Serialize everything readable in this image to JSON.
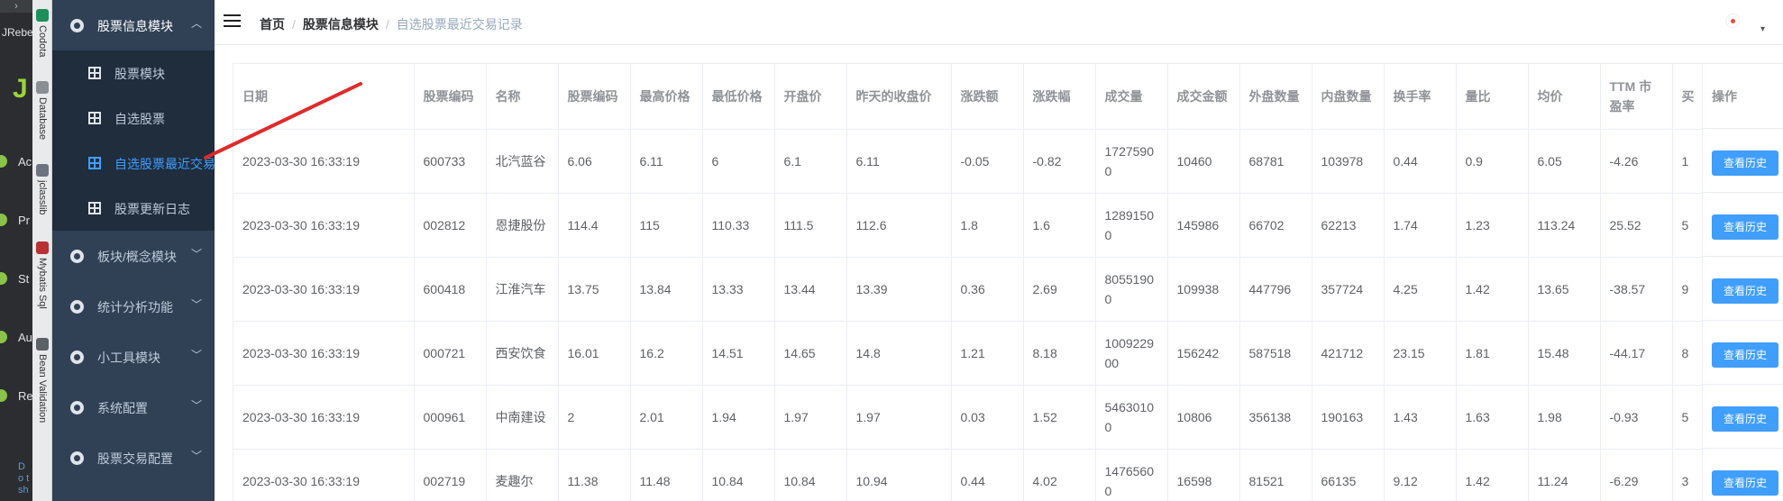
{
  "ide": {
    "plugin_label": "JRebe",
    "logo_letter": "J",
    "left_items": [
      {
        "label": "Ac"
      },
      {
        "label": "Pr"
      },
      {
        "label": "St"
      },
      {
        "label": "Au"
      },
      {
        "label": "Re"
      }
    ],
    "bottom_link": "Do t sh",
    "vertical_tools": [
      "Codota",
      "Database",
      "jclasslib",
      "Mybatis Sql",
      "Bean Validation"
    ]
  },
  "sidebar": {
    "groups": [
      {
        "label": "股票信息模块",
        "open": true
      },
      {
        "label": "板块/概念模块"
      },
      {
        "label": "统计分析功能"
      },
      {
        "label": "小工具模块"
      },
      {
        "label": "系统配置"
      },
      {
        "label": "股票交易配置"
      }
    ],
    "sub_items": [
      {
        "label": "股票模块"
      },
      {
        "label": "自选股票"
      },
      {
        "label": "自选股票最近交易记录",
        "active": true
      },
      {
        "label": "股票更新日志"
      }
    ]
  },
  "breadcrumb": {
    "home": "首页",
    "module": "股票信息模块",
    "current": "自选股票最近交易记录",
    "sep": "/"
  },
  "table": {
    "headers": [
      "日期",
      "股票编码",
      "名称",
      "股票编码",
      "最高价格",
      "最低价格",
      "开盘价",
      "昨天的收盘价",
      "涨跌额",
      "涨跌幅",
      "成交量",
      "成交金额",
      "外盘数量",
      "内盘数量",
      "换手率",
      "量比",
      "均价",
      "TTM 市盈率",
      "买"
    ],
    "op_header": "操作",
    "op_button": "查看历史",
    "rows": [
      [
        "2023-03-30 16:33:19",
        "600733",
        "北汽蓝谷",
        "6.06",
        "6.11",
        "6",
        "6.1",
        "6.11",
        "-0.05",
        "-0.82",
        "17275900",
        "10460",
        "68781",
        "103978",
        "0.44",
        "0.9",
        "6.05",
        "-4.26",
        "1"
      ],
      [
        "2023-03-30 16:33:19",
        "002812",
        "恩捷股份",
        "114.4",
        "115",
        "110.33",
        "111.5",
        "112.6",
        "1.8",
        "1.6",
        "12891500",
        "145986",
        "66702",
        "62213",
        "1.74",
        "1.23",
        "113.24",
        "25.52",
        "5"
      ],
      [
        "2023-03-30 16:33:19",
        "600418",
        "江淮汽车",
        "13.75",
        "13.84",
        "13.33",
        "13.44",
        "13.39",
        "0.36",
        "2.69",
        "80551900",
        "109938",
        "447796",
        "357724",
        "4.25",
        "1.42",
        "13.65",
        "-38.57",
        "9"
      ],
      [
        "2023-03-30 16:33:19",
        "000721",
        "西安饮食",
        "16.01",
        "16.2",
        "14.51",
        "14.65",
        "14.8",
        "1.21",
        "8.18",
        "100922900",
        "156242",
        "587518",
        "421712",
        "23.15",
        "1.81",
        "15.48",
        "-44.17",
        "8"
      ],
      [
        "2023-03-30 16:33:19",
        "000961",
        "中南建设",
        "2",
        "2.01",
        "1.94",
        "1.97",
        "1.97",
        "0.03",
        "1.52",
        "54630100",
        "10806",
        "356138",
        "190163",
        "1.43",
        "1.63",
        "1.98",
        "-0.93",
        "5"
      ],
      [
        "2023-03-30 16:33:19",
        "002719",
        "麦趣尔",
        "11.38",
        "11.48",
        "10.84",
        "10.84",
        "10.94",
        "0.44",
        "4.02",
        "14765600",
        "16598",
        "81521",
        "66135",
        "9.12",
        "1.42",
        "11.24",
        "-6.29",
        "3"
      ]
    ]
  },
  "colors": {
    "sidebar_bg": "#304156",
    "submenu_bg": "#1f2d3d",
    "accent": "#409eff",
    "annotation_arrow": "#e02a2a"
  }
}
